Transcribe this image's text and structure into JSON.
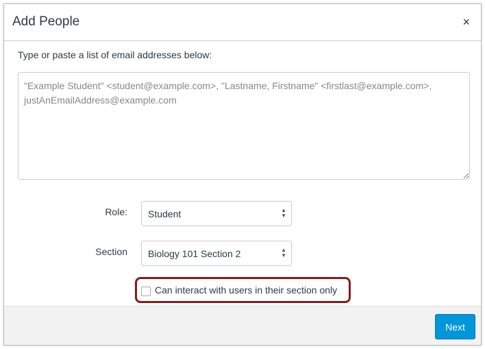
{
  "dialog": {
    "title": "Add People",
    "close_icon": "×"
  },
  "instructions": "Type or paste a list of email addresses below:",
  "emails": {
    "value": "",
    "placeholder": "\"Example Student\" <student@example.com>, \"Lastname, Firstname\" <firstlast@example.com>, justAnEmailAddress@example.com"
  },
  "role": {
    "label": "Role:",
    "value": "Student"
  },
  "section": {
    "label": "Section",
    "value": "Biology 101 Section 2"
  },
  "limit_checkbox": {
    "label": "Can interact with users in their section only",
    "checked": false
  },
  "footer": {
    "next_label": "Next"
  },
  "colors": {
    "primary": "#0096db",
    "highlight": "#8b1a1a"
  }
}
